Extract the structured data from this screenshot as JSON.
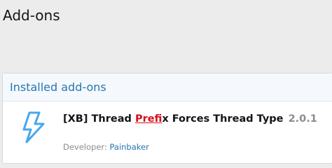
{
  "page": {
    "title": "Add-ons"
  },
  "installed": {
    "header": "Installed add-ons",
    "addons": [
      {
        "title_before": "[XB] Thread ",
        "title_highlight": "Pref",
        "title_after": "ix Forces Thread Type",
        "version": "2.0.1",
        "developer_label": "Developer:",
        "developer_name": "Painbaker",
        "icon": "bolt-icon"
      }
    ]
  },
  "colors": {
    "accent": "#2577b1",
    "highlight": "#d4101b",
    "muted": "#8c8c8c"
  }
}
